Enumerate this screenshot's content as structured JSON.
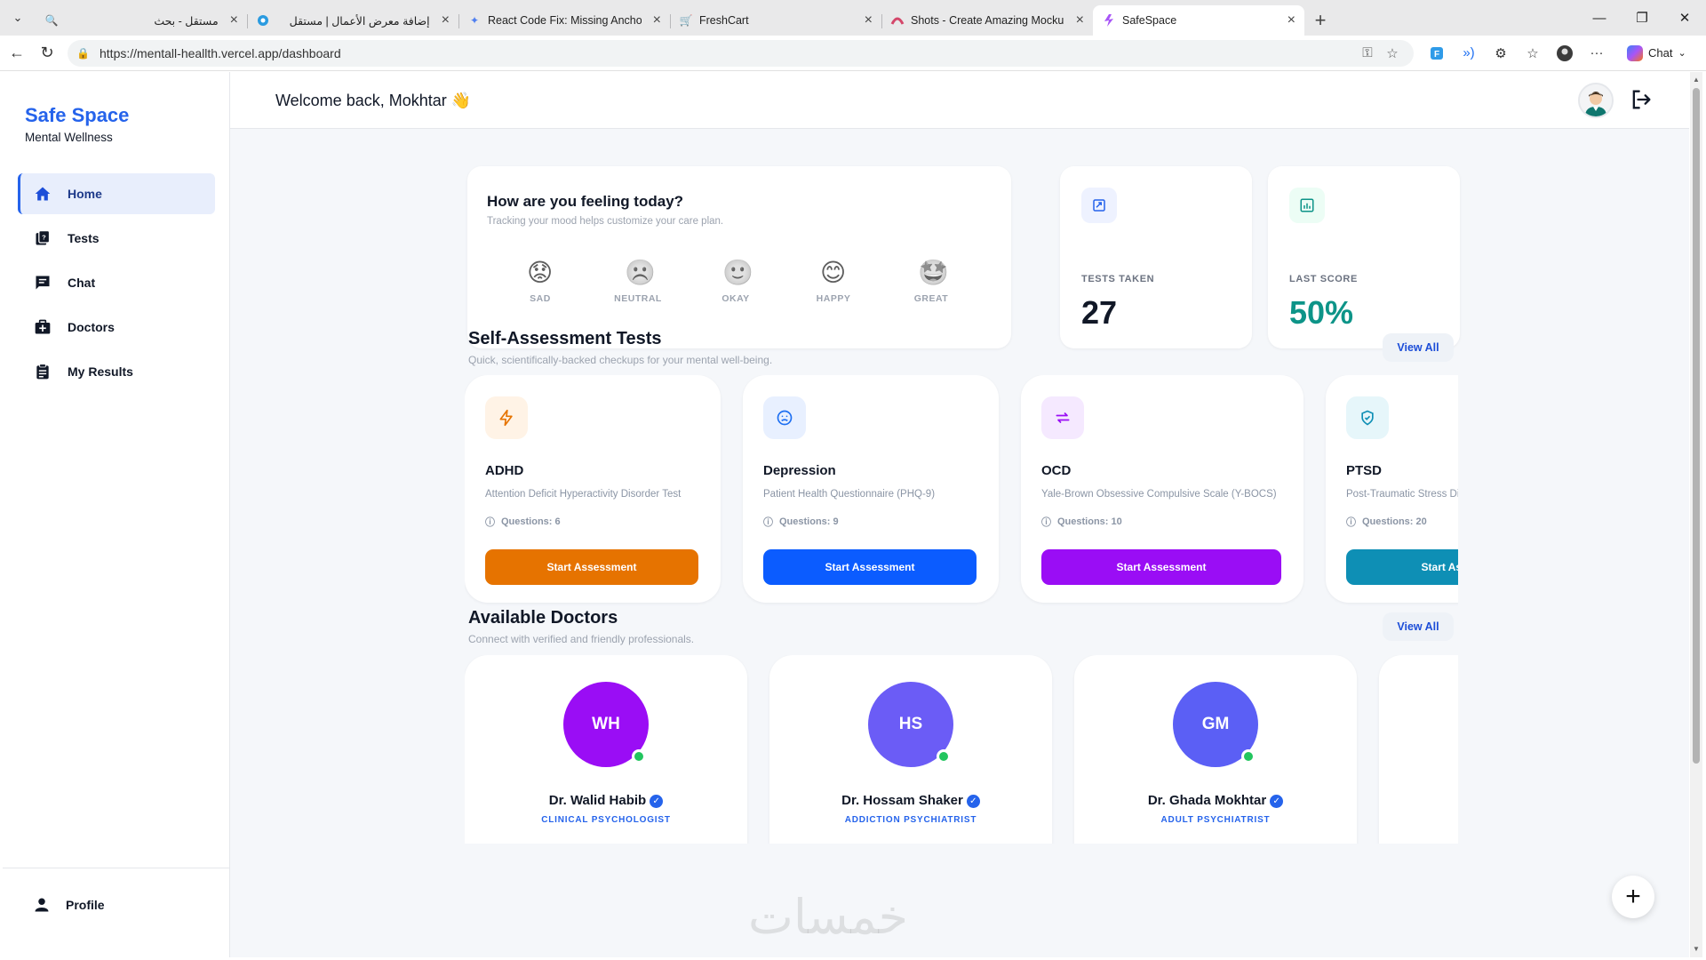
{
  "browser": {
    "tabs": [
      {
        "title": "مستقل - بحث",
        "icon": "search-icon",
        "active": false
      },
      {
        "title": "إضافة معرض الأعمال | مستقل",
        "icon": "mostaql-icon",
        "active": false
      },
      {
        "title": "React Code Fix: Missing Anchor Ta",
        "icon": "gemini-icon",
        "active": false
      },
      {
        "title": "FreshCart",
        "icon": "cart-icon",
        "active": false
      },
      {
        "title": "Shots - Create Amazing Mockups",
        "icon": "shots-icon",
        "active": false
      },
      {
        "title": "SafeSpace",
        "icon": "safespace-icon",
        "active": true
      }
    ],
    "url": "https://mentall-heallth.vercel.app/dashboard",
    "chat_label": "Chat"
  },
  "sidebar": {
    "brand_title": "Safe Space",
    "brand_sub": "Mental Wellness",
    "items": [
      {
        "label": "Home",
        "icon": "home-icon",
        "active": true
      },
      {
        "label": "Tests",
        "icon": "tests-icon",
        "active": false
      },
      {
        "label": "Chat",
        "icon": "chat-icon",
        "active": false
      },
      {
        "label": "Doctors",
        "icon": "doctors-icon",
        "active": false
      },
      {
        "label": "My Results",
        "icon": "results-icon",
        "active": false
      }
    ],
    "profile_label": "Profile"
  },
  "header": {
    "welcome": "Welcome back, Mokhtar 👋"
  },
  "mood": {
    "title": "How are you feeling today?",
    "subtitle": "Tracking your mood helps customize your care plan.",
    "options": [
      {
        "label": "SAD",
        "emoji": "😟"
      },
      {
        "label": "NEUTRAL",
        "emoji": "☹️"
      },
      {
        "label": "OKAY",
        "emoji": "🙂"
      },
      {
        "label": "HAPPY",
        "emoji": "😊"
      },
      {
        "label": "GREAT",
        "emoji": "🤩"
      }
    ]
  },
  "stats": {
    "tests_taken_label": "TESTS TAKEN",
    "tests_taken_value": "27",
    "last_score_label": "LAST SCORE",
    "last_score_value": "50%",
    "last_score_color": "#0d9488"
  },
  "tests_section": {
    "title": "Self-Assessment Tests",
    "subtitle": "Quick, scientifically-backed checkups for your mental well-being.",
    "view_all": "View All",
    "tests": [
      {
        "name": "ADHD",
        "desc": "Attention Deficit Hyperactivity Disorder Test",
        "questions": "Questions: 6",
        "button": "Start Assessment",
        "color": "#e67300",
        "icon_bg": "#fff3e6",
        "icon": "lightning-icon"
      },
      {
        "name": "Depression",
        "desc": "Patient Health Questionnaire (PHQ-9)",
        "questions": "Questions: 9",
        "button": "Start Assessment",
        "color": "#0b5cff",
        "icon_bg": "#e8f0ff",
        "icon": "sad-face-icon"
      },
      {
        "name": "OCD",
        "desc": "Yale-Brown Obsessive Compulsive Scale (Y-BOCS)",
        "questions": "Questions: 10",
        "button": "Start Assessment",
        "color": "#9a0df5",
        "icon_bg": "#f5e9ff",
        "icon": "repeat-icon"
      },
      {
        "name": "PTSD",
        "desc": "Post-Traumatic Stress Disorder",
        "questions": "Questions: 20",
        "button": "Start Assessment",
        "color": "#0e8fb5",
        "icon_bg": "#e6f6fa",
        "icon": "shield-icon"
      }
    ]
  },
  "doctors_section": {
    "title": "Available Doctors",
    "subtitle": "Connect with verified and friendly professionals.",
    "view_all": "View All",
    "doctors": [
      {
        "initials": "WH",
        "name": "Dr. Walid Habib",
        "role": "CLINICAL PSYCHOLOGIST",
        "color": "#9a0df5"
      },
      {
        "initials": "HS",
        "name": "Dr. Hossam Shaker",
        "role": "ADDICTION PSYCHIATRIST",
        "color": "#6b5cf6"
      },
      {
        "initials": "GM",
        "name": "Dr. Ghada Mokhtar",
        "role": "ADULT PSYCHIATRIST",
        "color": "#5b5ff5"
      },
      {
        "initials": "",
        "name": "",
        "role": "",
        "color": "#ffffff"
      }
    ]
  },
  "watermark": "خمسات"
}
